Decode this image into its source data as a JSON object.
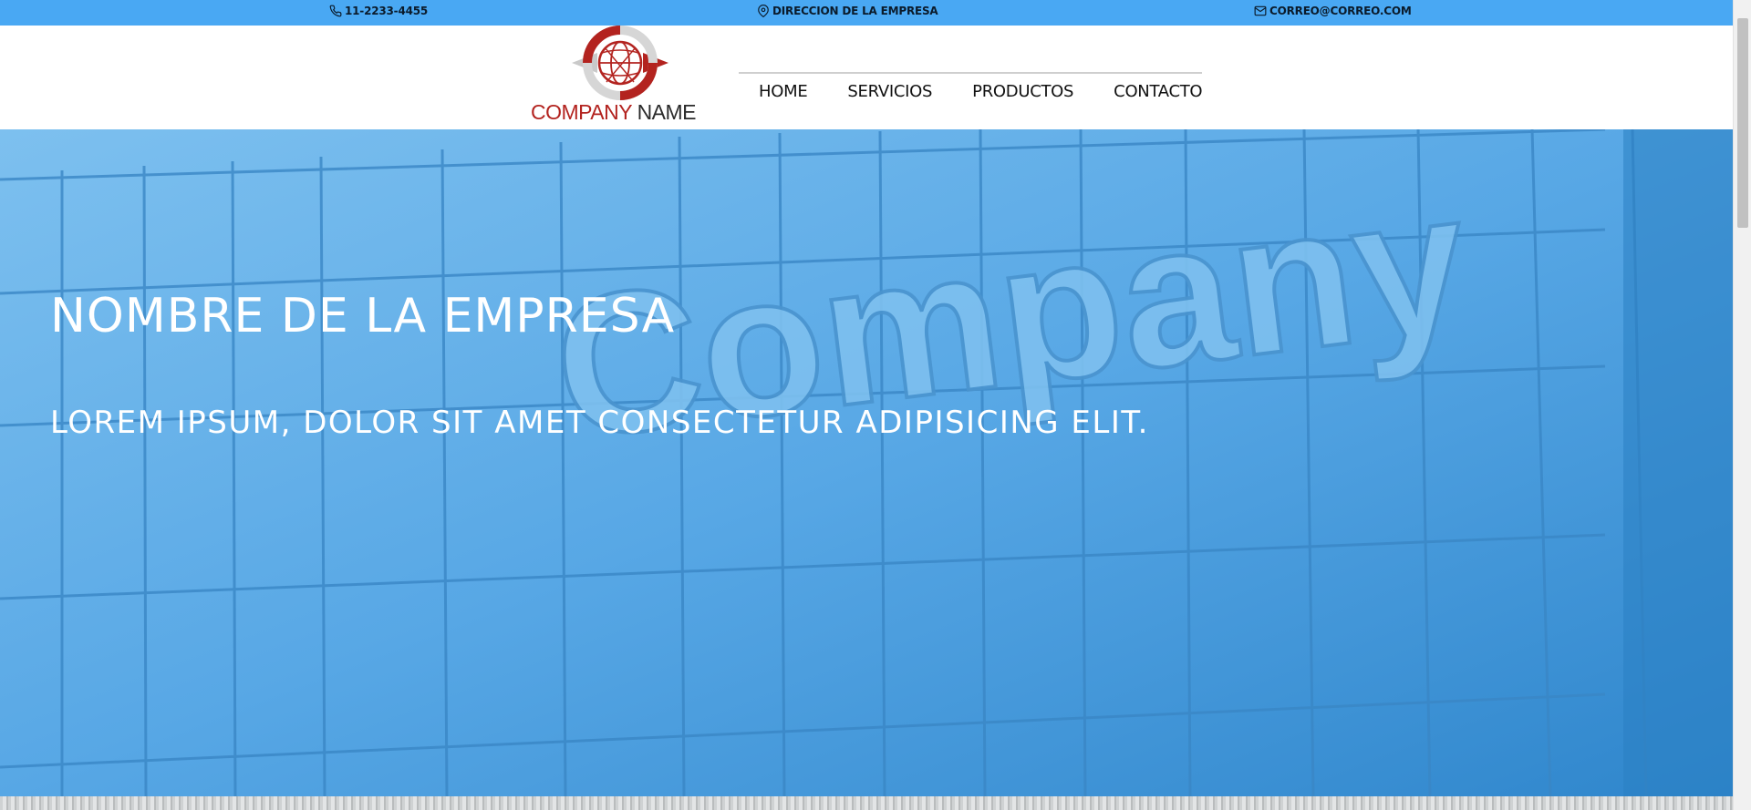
{
  "topbar": {
    "phone": "11-2233-4455",
    "address": "DIRECCION DE LA EMPRESA",
    "email": "CORREO@CORREO.COM"
  },
  "logo": {
    "word1": "COMPANY",
    "word2": "NAME"
  },
  "nav": {
    "items": [
      {
        "label": "HOME"
      },
      {
        "label": "SERVICIOS"
      },
      {
        "label": "PRODUCTOS"
      },
      {
        "label": "CONTACTO"
      }
    ]
  },
  "hero": {
    "title": "NOMBRE DE LA EMPRESA",
    "subtitle": "LOREM IPSUM, DOLOR SIT AMET CONSECTETUR ADIPISICING ELIT.",
    "sign_text": "Company"
  },
  "colors": {
    "topbar": "#49a8f3",
    "brand_red": "#b3231f",
    "hero_blue": "#4b9fe0"
  },
  "icons": {
    "phone": "phone-icon",
    "address": "map-pin-icon",
    "email": "mail-icon"
  }
}
